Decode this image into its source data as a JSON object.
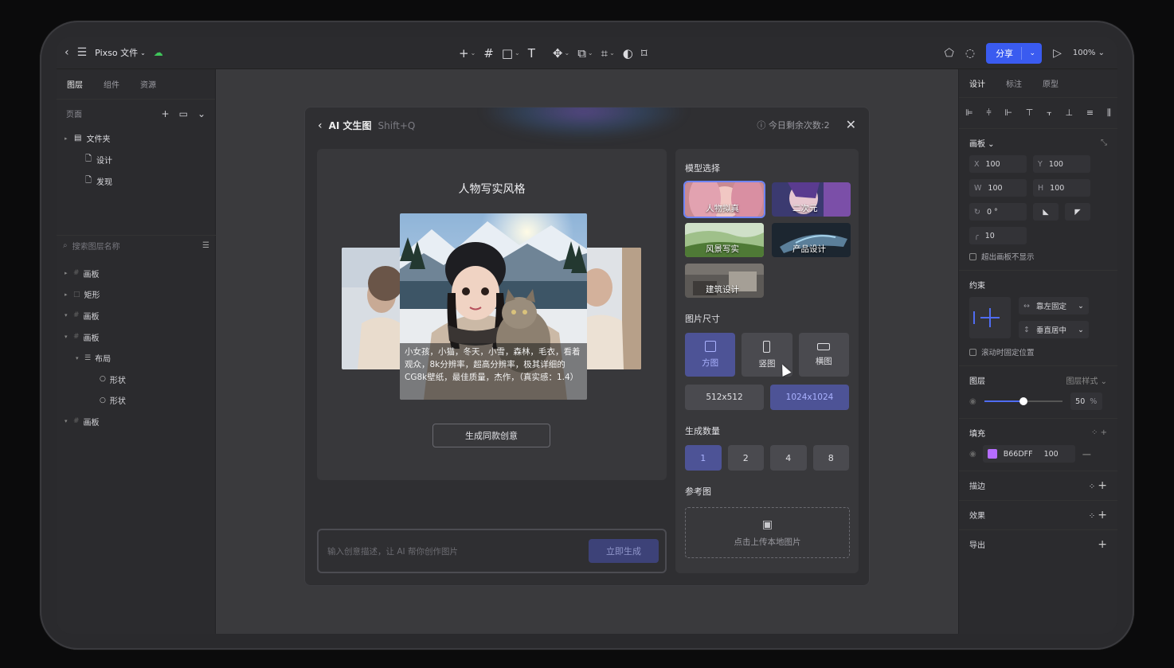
{
  "toolbar": {
    "file_title": "Pixso 文件",
    "share_label": "分享",
    "zoom": "100%"
  },
  "left_panel": {
    "tabs": [
      "图层",
      "组件",
      "资源"
    ],
    "pages_header": "页面",
    "pages": [
      {
        "label": "文件夹",
        "icon": "folder-icon"
      },
      {
        "label": "设计",
        "icon": "page-icon"
      },
      {
        "label": "发现",
        "icon": "page-icon"
      }
    ],
    "search_placeholder": "搜索图层名称",
    "layers": [
      {
        "label": "画板",
        "icon": "frame-icon",
        "indent": 0
      },
      {
        "label": "矩形",
        "icon": "rect-icon",
        "indent": 0
      },
      {
        "label": "画板",
        "icon": "frame-icon",
        "indent": 0
      },
      {
        "label": "画板",
        "icon": "frame-icon",
        "indent": 0
      },
      {
        "label": "布局",
        "icon": "layout-icon",
        "indent": 1
      },
      {
        "label": "形状",
        "icon": "circle-icon",
        "indent": 2
      },
      {
        "label": "形状",
        "icon": "circle-icon",
        "indent": 2
      },
      {
        "label": "画板",
        "icon": "frame-icon",
        "indent": 0
      }
    ]
  },
  "dialog": {
    "title": "AI 文生图",
    "shortcut": "Shift+Q",
    "remaining": "今日剩余次数:2",
    "preview_title": "人物写实风格",
    "caption": "小女孩，小猫，冬天，小雪，森林，毛衣，看着观众，8k分辨率，超高分辨率，极其详细的CG8k壁纸，最佳质量，杰作，（真实感：1.4）",
    "generate_same": "生成同款创意",
    "prompt_placeholder": "输入创意描述，让 AI 帮你创作图片",
    "generate_now": "立即生成",
    "model_label": "模型选择",
    "models": [
      "人物拟真",
      "二次元",
      "风景写实",
      "产品设计",
      "建筑设计"
    ],
    "size_label": "图片尺寸",
    "sizes": [
      "方图",
      "竖图",
      "横图"
    ],
    "resolutions": [
      "512x512",
      "1024x1024"
    ],
    "count_label": "生成数量",
    "counts": [
      "1",
      "2",
      "4",
      "8"
    ],
    "reference_label": "参考图",
    "upload_text": "点击上传本地图片"
  },
  "right_panel": {
    "tabs": [
      "设计",
      "标注",
      "原型"
    ],
    "frame_label": "画板",
    "x": "100",
    "y": "100",
    "w": "100",
    "h": "100",
    "rotation": "0 °",
    "radius": "10",
    "clip_label": "超出画板不显示",
    "constraint_label": "约束",
    "constraint_h": "靠左固定",
    "constraint_v": "垂直居中",
    "scroll_fixed": "滚动时固定位置",
    "layer_label": "图层",
    "layer_style": "图层样式",
    "opacity": "50",
    "opacity_unit": "%",
    "fill_label": "填充",
    "fill_hex": "B66DFF",
    "fill_opacity": "100",
    "fill_color": "#B66DFF",
    "stroke_label": "描边",
    "effect_label": "效果",
    "export_label": "导出"
  }
}
